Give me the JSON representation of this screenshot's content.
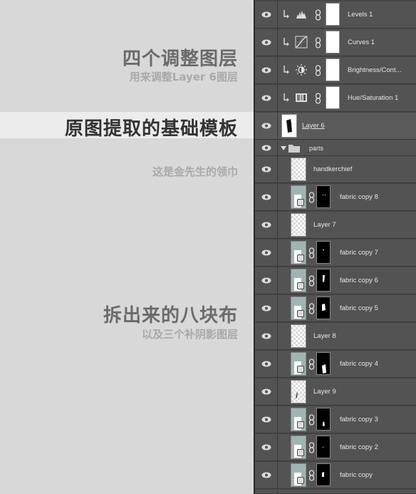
{
  "annotations": {
    "adjust_title": "四个调整图层",
    "adjust_sub": "用来调整Layer 6图层",
    "template_title": "原图提取的基础模板",
    "collar_note": "这是金先生的领巾",
    "pieces_title": "拆出来的八块布",
    "pieces_sub": "以及三个补阴影图层"
  },
  "layers": {
    "levels": "Levels 1",
    "curves": "Curves 1",
    "brightness": "Brightness/Cont...",
    "huesat": "Hue/Saturation 1",
    "layer6": "Layer 6",
    "parts": "parts",
    "handkerchief": "handkerchief",
    "fabric8": "fabric copy 8",
    "layer7": "Layer 7",
    "fabric7": "fabric copy 7",
    "fabric6": "fabric copy 6",
    "fabric5": "fabric copy 5",
    "layer8": "Layer 8",
    "fabric4": "fabric copy 4",
    "layer9": "Layer 9",
    "fabric3": "fabric copy 3",
    "fabric2": "fabric copy 2",
    "fabric": "fabric copy"
  },
  "colors": {
    "panel_bg": "#535353",
    "annotation_bg": "#d8d8d8",
    "fabric_thumb": "#9fb5b3"
  }
}
